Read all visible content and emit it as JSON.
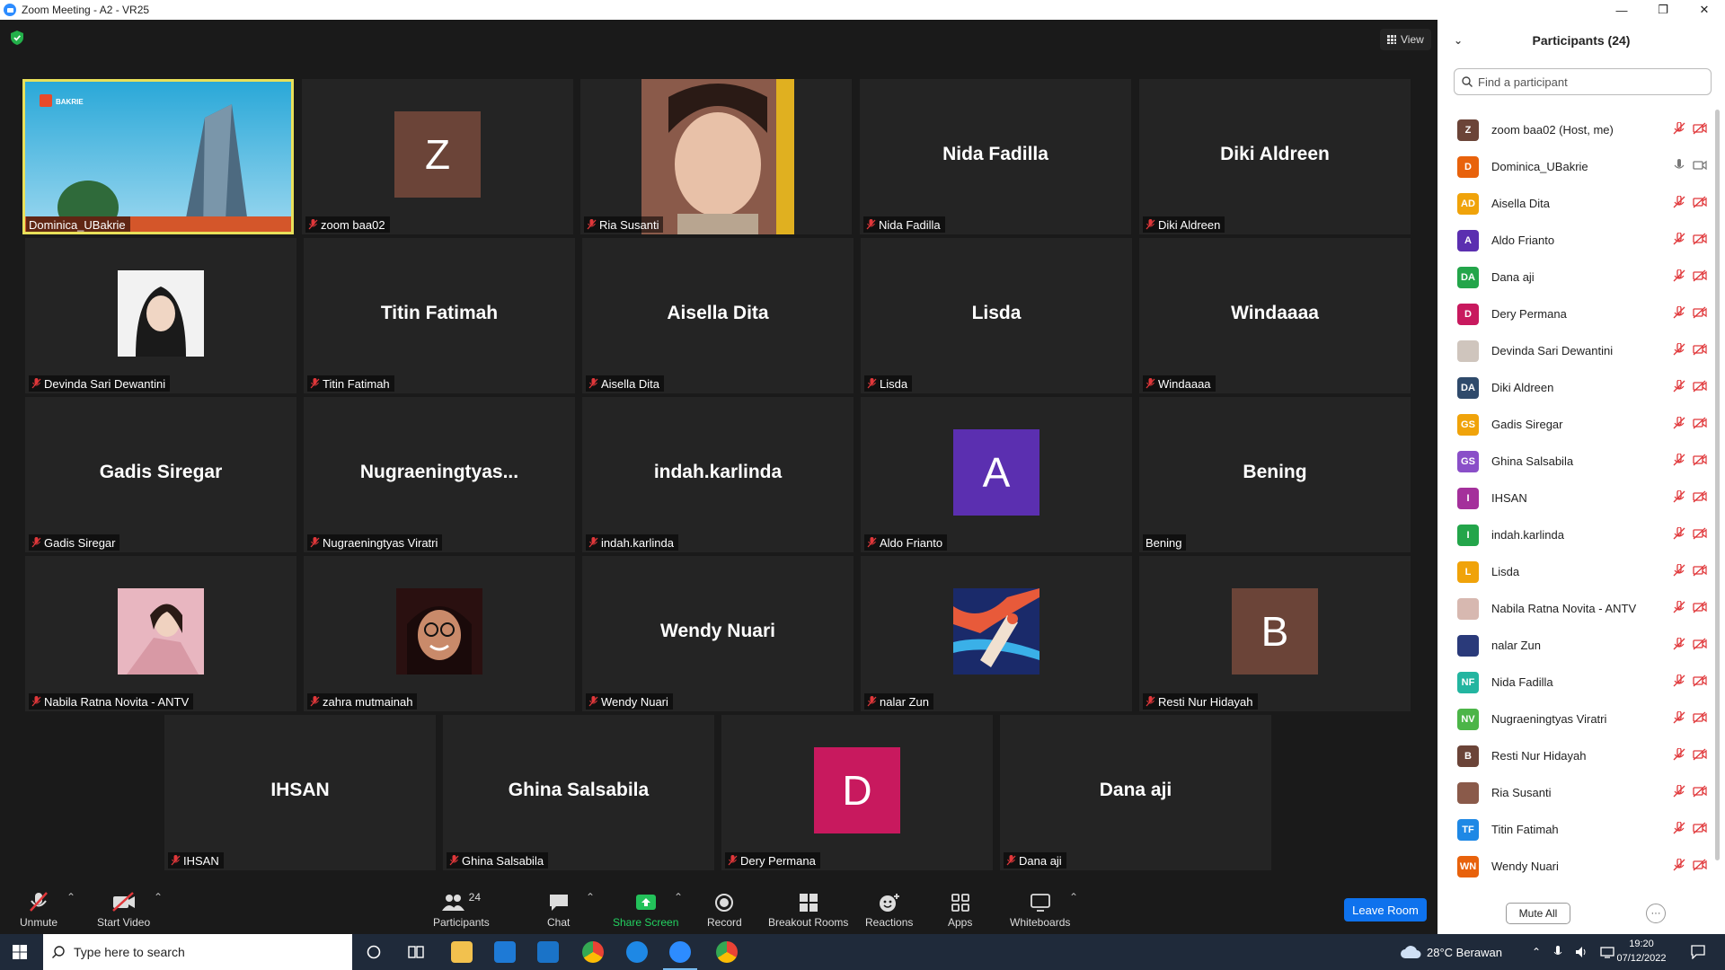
{
  "window": {
    "title": "Zoom Meeting - A2 - VR25",
    "minimize": "—",
    "maximize": "❐",
    "close": "✕"
  },
  "view_label": "View",
  "tiles": [
    {
      "label": "Dominica_UBakrie"
    },
    {
      "label": "zoom baa02",
      "avatar_letter": "Z",
      "avatar_color": "#6b4438"
    },
    {
      "label": "Ria Susanti"
    },
    {
      "label": "Nida Fadilla",
      "big_name": "Nida Fadilla"
    },
    {
      "label": "Diki Aldreen",
      "big_name": "Diki Aldreen"
    },
    {
      "label": "Devinda Sari Dewantini"
    },
    {
      "label": "Titin Fatimah",
      "big_name": "Titin Fatimah"
    },
    {
      "label": "Aisella Dita",
      "big_name": "Aisella Dita"
    },
    {
      "label": "Lisda",
      "big_name": "Lisda"
    },
    {
      "label": "Windaaaa",
      "big_name": "Windaaaa"
    },
    {
      "label": "Gadis Siregar",
      "big_name": "Gadis Siregar"
    },
    {
      "label": "Nugraeningtyas Viratri",
      "big_name": "Nugraeningtyas..."
    },
    {
      "label": "indah.karlinda",
      "big_name": "indah.karlinda"
    },
    {
      "label": "Aldo Frianto",
      "avatar_letter": "A",
      "avatar_color": "#5b2fb0"
    },
    {
      "label": "Bening",
      "big_name": "Bening"
    },
    {
      "label": "Nabila Ratna Novita - ANTV"
    },
    {
      "label": "zahra mutmainah"
    },
    {
      "label": "Wendy Nuari",
      "big_name": "Wendy Nuari"
    },
    {
      "label": "nalar Zun"
    },
    {
      "label": "Resti Nur Hidayah",
      "avatar_letter": "B",
      "avatar_color": "#6b4438"
    },
    {
      "label": "IHSAN",
      "big_name": "IHSAN"
    },
    {
      "label": "Ghina Salsabila",
      "big_name": "Ghina Salsabila"
    },
    {
      "label": "Dery Permana",
      "avatar_letter": "D",
      "avatar_color": "#c8195e"
    },
    {
      "label": "Dana aji",
      "big_name": "Dana aji"
    }
  ],
  "tile_photo_text": {
    "bakrie_logo": "BAKRIE"
  },
  "toolbar": {
    "unmute": "Unmute",
    "start_video": "Start Video",
    "participants": "Participants",
    "participants_count": "24",
    "chat": "Chat",
    "share_screen": "Share Screen",
    "record": "Record",
    "breakout_rooms": "Breakout Rooms",
    "reactions": "Reactions",
    "apps": "Apps",
    "whiteboards": "Whiteboards",
    "leave_room": "Leave Room"
  },
  "panel": {
    "title": "Participants (24)",
    "search_placeholder": "Find a participant",
    "mute_all": "Mute All",
    "more": "···",
    "participants": [
      {
        "name": "zoom baa02 (Host, me)",
        "initials": "Z",
        "color": "#6b4438"
      },
      {
        "name": "Dominica_UBakrie",
        "initials": "D",
        "color": "#e8620c",
        "audio": "on"
      },
      {
        "name": "Aisella Dita",
        "initials": "AD",
        "color": "#f0a30a"
      },
      {
        "name": "Aldo Frianto",
        "initials": "A",
        "color": "#5b2fb0"
      },
      {
        "name": "Dana aji",
        "initials": "DA",
        "color": "#23a54a"
      },
      {
        "name": "Dery Permana",
        "initials": "D",
        "color": "#c8195e"
      },
      {
        "name": "Devinda Sari Dewantini",
        "initials": "",
        "color": "#cfc5bd",
        "photo": true
      },
      {
        "name": "Diki Aldreen",
        "initials": "DA",
        "color": "#2f4a6b"
      },
      {
        "name": "Gadis Siregar",
        "initials": "GS",
        "color": "#f0a30a"
      },
      {
        "name": "Ghina Salsabila",
        "initials": "GS",
        "color": "#8a4fc8"
      },
      {
        "name": "IHSAN",
        "initials": "I",
        "color": "#a4309b"
      },
      {
        "name": "indah.karlinda",
        "initials": "I",
        "color": "#23a54a"
      },
      {
        "name": "Lisda",
        "initials": "L",
        "color": "#f0a30a"
      },
      {
        "name": "Nabila Ratna Novita - ANTV",
        "initials": "",
        "color": "#d7b8b0",
        "photo": true
      },
      {
        "name": "nalar Zun",
        "initials": "",
        "color": "#2a3a7a",
        "photo": true
      },
      {
        "name": "Nida Fadilla",
        "initials": "NF",
        "color": "#23b5a0"
      },
      {
        "name": "Nugraeningtyas Viratri",
        "initials": "NV",
        "color": "#4cb548"
      },
      {
        "name": "Resti Nur Hidayah",
        "initials": "B",
        "color": "#6b4438"
      },
      {
        "name": "Ria Susanti",
        "initials": "",
        "color": "#8a5a4a",
        "photo": true
      },
      {
        "name": "Titin Fatimah",
        "initials": "TF",
        "color": "#1e88e5"
      },
      {
        "name": "Wendy Nuari",
        "initials": "WN",
        "color": "#e8620c"
      }
    ]
  },
  "taskbar": {
    "search_placeholder": "Type here to search",
    "weather": "28°C  Berawan",
    "time": "19:20",
    "date": "07/12/2022"
  }
}
